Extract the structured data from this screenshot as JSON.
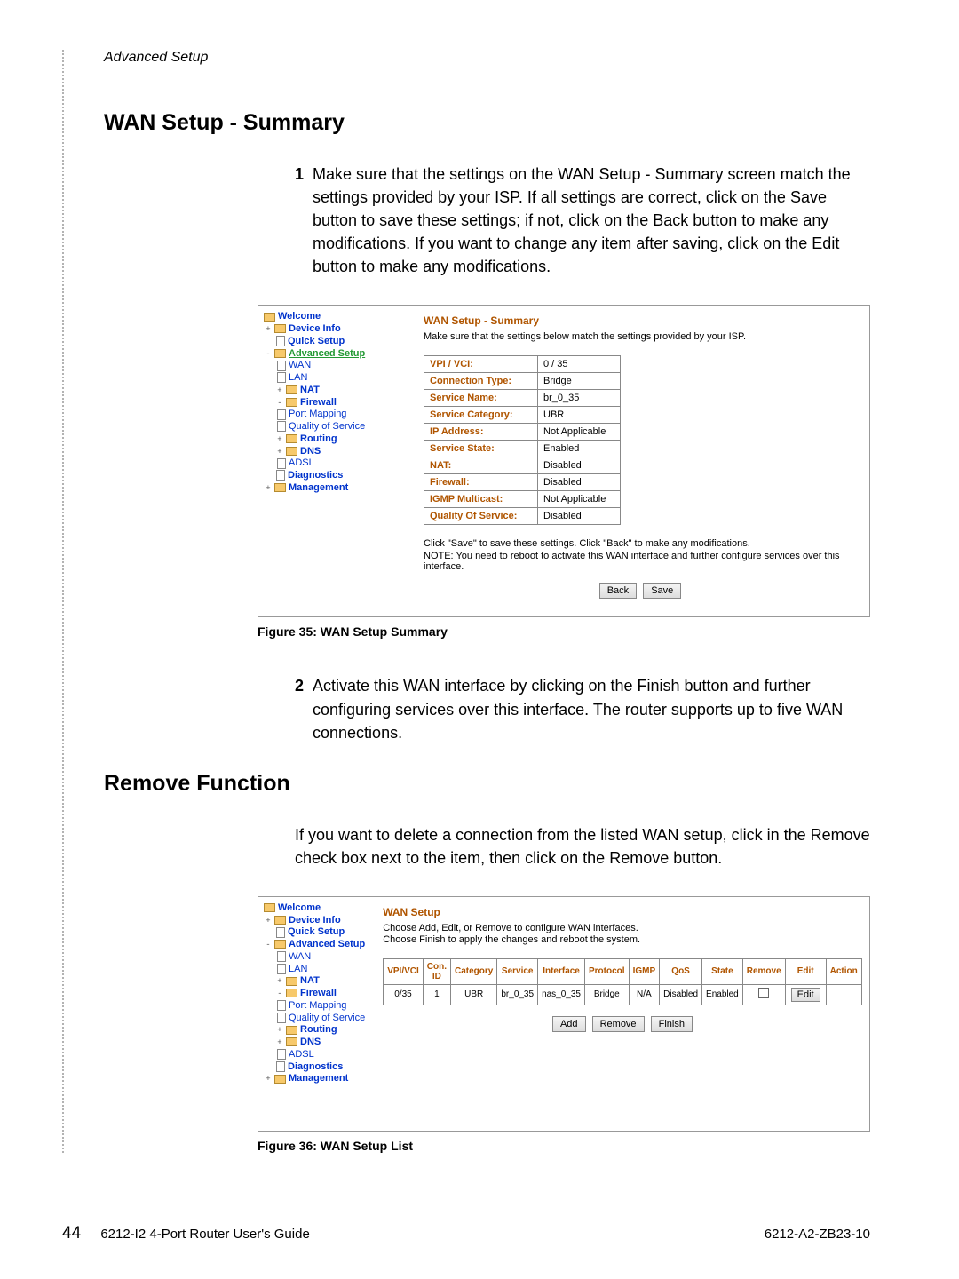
{
  "header": {
    "section": "Advanced Setup"
  },
  "sec1": {
    "title": "WAN Setup - Summary",
    "step1_num": "1",
    "step1_text": "Make sure that the settings on the WAN Setup - Summary screen match the settings provided by your ISP. If all settings are correct, click on the Save button to save these settings; if not, click on the Back button to make any modifications. If you want to change any item after saving, click on the Edit button to make any modifications.",
    "caption": "Figure 35: WAN Setup Summary",
    "step2_num": "2",
    "step2_text": "Activate this WAN interface by clicking on the Finish button and further configuring services over this interface. The router supports up to five WAN connections."
  },
  "sec2": {
    "title": "Remove Function",
    "text": "If you want to delete a connection from the listed WAN setup, click in the Remove check box next to the item, then click on the Remove button.",
    "caption": "Figure 36: WAN Setup List"
  },
  "tree": {
    "welcome": "Welcome",
    "device_info": "Device Info",
    "quick_setup": "Quick Setup",
    "advanced_setup": "Advanced Setup",
    "wan": "WAN",
    "lan": "LAN",
    "nat": "NAT",
    "firewall": "Firewall",
    "port_mapping": "Port Mapping",
    "qos": "Quality of Service",
    "routing": "Routing",
    "dns": "DNS",
    "adsl": "ADSL",
    "diagnostics": "Diagnostics",
    "management": "Management"
  },
  "fig35": {
    "title": "WAN Setup - Summary",
    "desc": "Make sure that the settings below match the settings provided by your ISP.",
    "rows": [
      {
        "k": "VPI / VCI:",
        "v": "0 / 35"
      },
      {
        "k": "Connection Type:",
        "v": "Bridge"
      },
      {
        "k": "Service Name:",
        "v": "br_0_35"
      },
      {
        "k": "Service Category:",
        "v": "UBR"
      },
      {
        "k": "IP Address:",
        "v": "Not Applicable"
      },
      {
        "k": "Service State:",
        "v": "Enabled"
      },
      {
        "k": "NAT:",
        "v": "Disabled"
      },
      {
        "k": "Firewall:",
        "v": "Disabled"
      },
      {
        "k": "IGMP Multicast:",
        "v": "Not Applicable"
      },
      {
        "k": "Quality Of Service:",
        "v": "Disabled"
      }
    ],
    "note1": "Click \"Save\" to save these settings. Click \"Back\" to make any modifications.",
    "note2": "NOTE: You need to reboot to activate this WAN interface and further configure services over this interface.",
    "back": "Back",
    "save": "Save"
  },
  "fig36": {
    "title": "WAN Setup",
    "desc1": "Choose Add, Edit, or Remove to configure WAN interfaces.",
    "desc2": "Choose Finish to apply the changes and reboot the system.",
    "headers": [
      "VPI/VCI",
      "Con. ID",
      "Category",
      "Service",
      "Interface",
      "Protocol",
      "IGMP",
      "QoS",
      "State",
      "Remove",
      "Edit",
      "Action"
    ],
    "row": {
      "vpivci": "0/35",
      "conid": "1",
      "cat": "UBR",
      "service": "br_0_35",
      "iface": "nas_0_35",
      "proto": "Bridge",
      "igmp": "N/A",
      "qos": "Disabled",
      "state": "Enabled",
      "edit": "Edit"
    },
    "add": "Add",
    "remove": "Remove",
    "finish": "Finish"
  },
  "footer": {
    "page": "44",
    "guide": "6212-I2 4-Port Router User's Guide",
    "docnum": "6212-A2-ZB23-10"
  }
}
